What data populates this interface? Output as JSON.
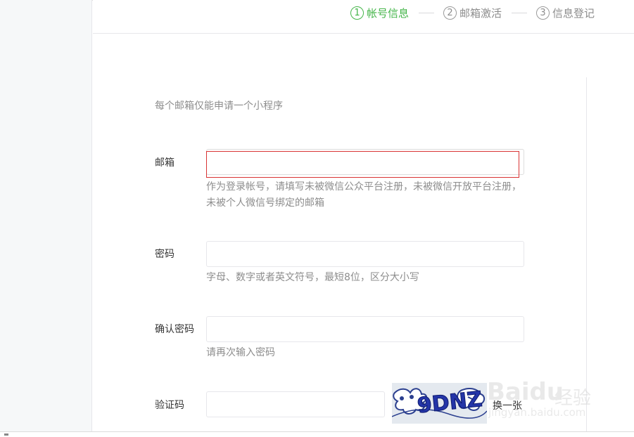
{
  "steps": [
    {
      "number": "1",
      "label": "帐号信息",
      "active": true
    },
    {
      "number": "2",
      "label": "邮箱激活",
      "active": false
    },
    {
      "number": "3",
      "label": "信息登记",
      "active": false
    }
  ],
  "form": {
    "notice": "每个邮箱仅能申请一个小程序",
    "email": {
      "label": "邮箱",
      "value": "",
      "tip": "作为登录帐号，请填写未被微信公众平台注册，未被微信开放平台注册，未被个人微信号绑定的邮箱"
    },
    "password": {
      "label": "密码",
      "value": "",
      "tip": "字母、数字或者英文符号，最短8位，区分大小写"
    },
    "confirm_password": {
      "label": "确认密码",
      "value": "",
      "tip": "请再次输入密码"
    },
    "captcha": {
      "label": "验证码",
      "value": "",
      "image_text": "9DNZ",
      "refresh_label": "换一张"
    }
  },
  "watermark": {
    "brand": "Baidu",
    "brand_suffix": "经验",
    "url": "jingyan.baidu.com"
  },
  "colors": {
    "active": "#44b549",
    "error": "#d93434",
    "muted": "#8d8d8d",
    "border": "#e7e7eb"
  }
}
